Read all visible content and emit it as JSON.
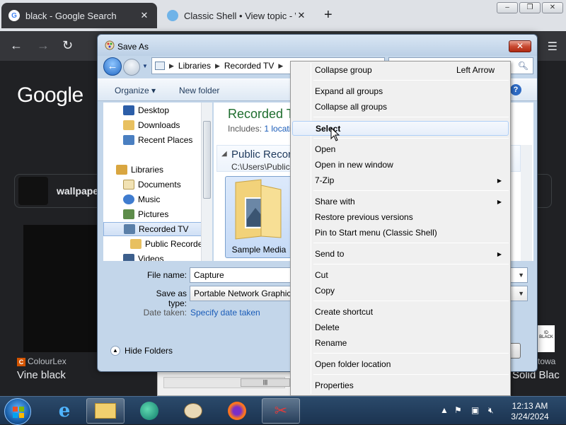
{
  "browser": {
    "tabs": [
      {
        "title": "black - Google Search",
        "favicon": "G"
      },
      {
        "title": "Classic Shell • View topic - Windo"
      }
    ],
    "new_tab_label": "+",
    "window_controls": [
      "–",
      "❐",
      "✕"
    ]
  },
  "page": {
    "logo": "Google",
    "result_title": "wallpape",
    "source_left": "ColourLex",
    "caption_left": "Vine black",
    "caption_right": "Solid Blac",
    "source_right": "towa",
    "thumb_right_text": "ID BLACK"
  },
  "dialog": {
    "title": "Save As",
    "breadcrumb": [
      "Libraries",
      "Recorded TV"
    ],
    "commands": {
      "organize": "Organize",
      "new_folder": "New folder"
    },
    "nav_items": [
      {
        "label": "Desktop"
      },
      {
        "label": "Downloads"
      },
      {
        "label": "Recent Places"
      },
      {
        "label": "Libraries"
      },
      {
        "label": "Documents"
      },
      {
        "label": "Music"
      },
      {
        "label": "Pictures"
      },
      {
        "label": "Recorded TV"
      },
      {
        "label": "Public Recorde"
      },
      {
        "label": "Videos"
      }
    ],
    "library_title": "Recorded T",
    "includes_label": "Includes:",
    "includes_link": "1 locati",
    "group_name": "Public Record",
    "group_path": "C:\\Users\\Public",
    "tile_label": "Sample Media",
    "file_name_label": "File name:",
    "file_name_value": "Capture",
    "save_type_label": "Save as type:",
    "save_type_value": "Portable Network Graphic",
    "date_label": "Date taken:",
    "date_link": "Specify date taken",
    "hide_folders": "Hide Folders"
  },
  "context_menu": {
    "items": [
      {
        "label": "Collapse group",
        "accel": "Left Arrow"
      },
      {
        "label": "Expand all groups"
      },
      {
        "label": "Collapse all groups"
      },
      {
        "label": "Select",
        "highlighted": true
      },
      {
        "label": "Open"
      },
      {
        "label": "Open in new window"
      },
      {
        "label": "7-Zip",
        "submenu": true
      },
      {
        "label": "Share with",
        "submenu": true
      },
      {
        "label": "Restore previous versions"
      },
      {
        "label": "Pin to Start menu (Classic Shell)"
      },
      {
        "label": "Send to",
        "submenu": true
      },
      {
        "label": "Cut"
      },
      {
        "label": "Copy"
      },
      {
        "label": "Create shortcut"
      },
      {
        "label": "Delete"
      },
      {
        "label": "Rename"
      },
      {
        "label": "Open folder location"
      },
      {
        "label": "Properties"
      }
    ]
  },
  "taskbar": {
    "time": "12:13 AM",
    "date": "3/24/2024",
    "items": [
      "start-orb",
      "internet-explorer-icon",
      "file-explorer-icon",
      "edge-icon",
      "paint-icon",
      "firefox-icon",
      "snipping-tool-icon"
    ]
  },
  "colors": {
    "dialog_frame": "#c3d6ea",
    "library_title": "#1e6d2e",
    "link": "#1a5cb8",
    "taskbar": "#1b3350"
  }
}
